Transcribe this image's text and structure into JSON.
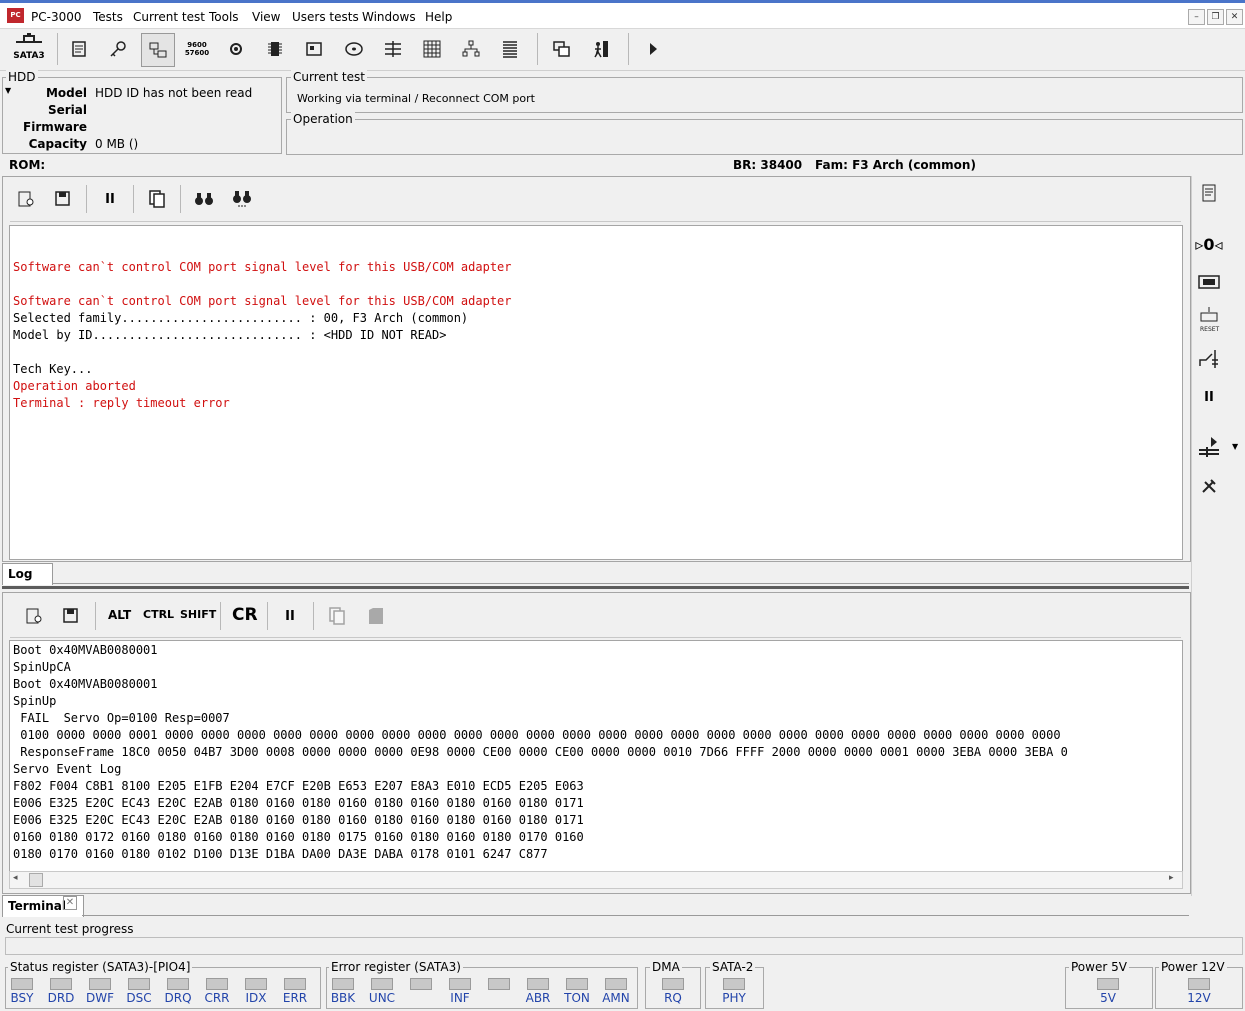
{
  "app": {
    "title": "PC-3000",
    "icon_text": "PC"
  },
  "menu": [
    "Tests",
    "Current test",
    "Tools",
    "View",
    "Users tests",
    "Windows",
    "Help"
  ],
  "toolbar": {
    "sata_label": "SATA3",
    "baud_label_top": "9600",
    "baud_label_bottom": "57600"
  },
  "hdd": {
    "group_label": "HDD",
    "model_label": "Model",
    "model_value": "HDD ID has not been read",
    "serial_label": "Serial",
    "serial_value": "",
    "firmware_label": "Firmware",
    "firmware_value": "",
    "capacity_label": "Capacity",
    "capacity_value": "0 MB ()"
  },
  "current_test": {
    "group_label": "Current test",
    "value": "Working via terminal / Reconnect COM port"
  },
  "operation": {
    "group_label": "Operation",
    "value": ""
  },
  "info_bar": {
    "rom_label": "ROM:",
    "br": "BR: 38400",
    "fam": "Fam: F3 Arch (common)"
  },
  "log": {
    "tab_label": "Log",
    "lines": [
      {
        "text": "",
        "color": "black"
      },
      {
        "text": "Software can`t control COM port signal level for this USB/COM adapter",
        "color": "red"
      },
      {
        "text": "",
        "color": "black"
      },
      {
        "text": "Software can`t control COM port signal level for this USB/COM adapter",
        "color": "red"
      },
      {
        "text": "Selected family......................... : 00, F3 Arch (common)",
        "color": "black"
      },
      {
        "text": "Model by ID............................. : <HDD ID NOT READ>",
        "color": "black"
      },
      {
        "text": "",
        "color": "black"
      },
      {
        "text": "Tech Key...",
        "color": "black"
      },
      {
        "text": "Operation aborted",
        "color": "red"
      },
      {
        "text": "Terminal : reply timeout error",
        "color": "red"
      }
    ]
  },
  "terminal": {
    "tab_label": "Terminal",
    "alt": "ALT",
    "ctrl": "CTRL",
    "shift": "SHIFT",
    "cr": "CR",
    "lines": [
      "Boot 0x40MVAB0080001",
      "SpinUpCA",
      "Boot 0x40MVAB0080001",
      "SpinUp",
      " FAIL  Servo Op=0100 Resp=0007",
      " 0100 0000 0000 0001 0000 0000 0000 0000 0000 0000 0000 0000 0000 0000 0000 0000 0000 0000 0000 0000 0000 0000 0000 0000 0000 0000 0000 0000 0000",
      " ResponseFrame 18C0 0050 04B7 3D00 0008 0000 0000 0000 0E98 0000 CE00 0000 CE00 0000 0000 0010 7D66 FFFF 2000 0000 0000 0001 0000 3EBA 0000 3EBA 0",
      "Servo Event Log",
      "F802 F004 C8B1 8100 E205 E1FB E204 E7CF E20B E653 E207 E8A3 E010 ECD5 E205 E063",
      "E006 E325 E20C EC43 E20C E2AB 0180 0160 0180 0160 0180 0160 0180 0160 0180 0171",
      "E006 E325 E20C EC43 E20C E2AB 0180 0160 0180 0160 0180 0160 0180 0160 0180 0171",
      "0160 0180 0172 0160 0180 0160 0180 0160 0180 0175 0160 0180 0160 0180 0170 0160",
      "0180 0170 0160 0180 0102 D100 D13E D1BA DA00 DA3E DABA 0178 0101 6247 C877"
    ]
  },
  "progress": {
    "label": "Current test progress",
    "value": 0
  },
  "status": {
    "status_reg_label": "Status register (SATA3)-[PIO4]",
    "status_bits": [
      "BSY",
      "DRD",
      "DWF",
      "DSC",
      "DRQ",
      "CRR",
      "IDX",
      "ERR"
    ],
    "error_reg_label": "Error register (SATA3)",
    "error_bits": [
      "BBK",
      "UNC",
      "",
      "INF",
      "",
      "ABR",
      "TON",
      "AMN"
    ],
    "dma_label": "DMA",
    "dma_bits": [
      "RQ"
    ],
    "sata2_label": "SATA-2",
    "sata2_bits": [
      "PHY"
    ],
    "power5_label": "Power 5V",
    "power5_bits": [
      "5V"
    ],
    "power12_label": "Power 12V",
    "power12_bits": [
      "12V"
    ]
  }
}
